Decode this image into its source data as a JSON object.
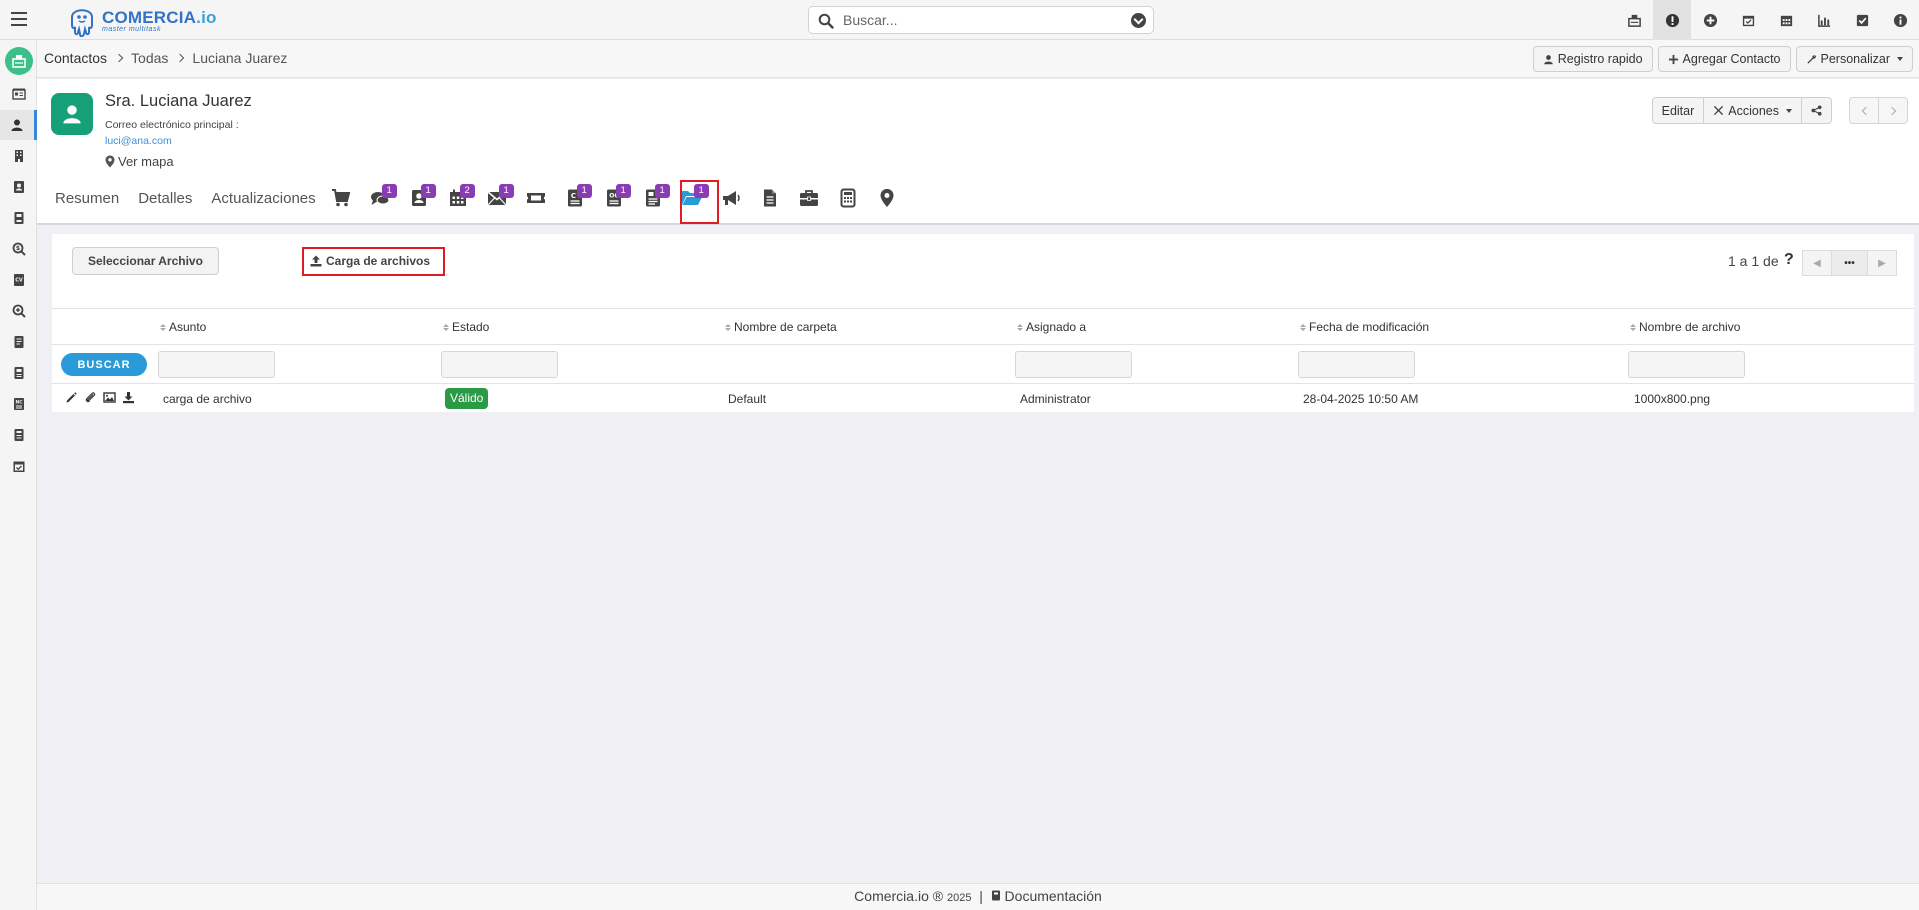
{
  "app": {
    "logo_name": "COMERCIA",
    "logo_tld": ".io",
    "logo_tagline": "master multitask"
  },
  "search": {
    "placeholder": "Buscar..."
  },
  "top_icons": [
    "desk-icon",
    "alert-icon",
    "plus-circle-icon",
    "calendar-check-icon",
    "calendar-icon",
    "chart-icon",
    "checkbox-icon",
    "info-icon"
  ],
  "sidebar": {
    "items": [
      "id-card-icon",
      "user-icon",
      "building-icon",
      "contact-book-icon",
      "book-icon",
      "search-dollar-icon",
      "cv-icon",
      "search-icon",
      "ledger-icon",
      "ledger2-icon",
      "nc-icon",
      "ledger3-icon",
      "calendar-check-icon"
    ]
  },
  "breadcrumb": {
    "root": "Contactos",
    "list": "Todas",
    "current": "Luciana Juarez"
  },
  "crumb_actions": {
    "quick": "Registro rapido",
    "add": "Agregar Contacto",
    "customize": "Personalizar"
  },
  "contact": {
    "name": "Sra. Luciana Juarez",
    "email_label": "Correo electrónico principal :",
    "email": "luci@ana.com",
    "map": "Ver mapa"
  },
  "header_actions": {
    "edit": "Editar",
    "actions": "Acciones"
  },
  "tabs": {
    "summary": "Resumen",
    "details": "Detalles",
    "updates": "Actualizaciones",
    "icons": [
      {
        "name": "cart-icon",
        "badge": ""
      },
      {
        "name": "comments-icon",
        "badge": "1"
      },
      {
        "name": "contact-card-icon",
        "badge": "1"
      },
      {
        "name": "calendar-icon",
        "badge": "2"
      },
      {
        "name": "envelope-icon",
        "badge": "1"
      },
      {
        "name": "ticket-icon",
        "badge": ""
      },
      {
        "name": "quote-icon",
        "badge": "1"
      },
      {
        "name": "order-icon",
        "badge": "1"
      },
      {
        "name": "invoice-icon",
        "badge": "1"
      },
      {
        "name": "folder-open-icon",
        "badge": "1"
      },
      {
        "name": "megaphone-icon",
        "badge": ""
      },
      {
        "name": "document-icon",
        "badge": ""
      },
      {
        "name": "briefcase-icon",
        "badge": ""
      },
      {
        "name": "calculator-icon",
        "badge": ""
      },
      {
        "name": "map-marker-icon",
        "badge": ""
      }
    ]
  },
  "files": {
    "select_button": "Seleccionar Archivo",
    "upload_button": "Carga de archivos",
    "pager_text": "1 a 1  de",
    "search_button": "BUSCAR",
    "columns": [
      "Asunto",
      "Estado",
      "Nombre de carpeta",
      "Asignado a",
      "Fecha de modificación",
      "Nombre de archivo"
    ],
    "rows": [
      {
        "subject": "carga de archivo",
        "status": "Válido",
        "folder": "Default",
        "assigned": "Administrator",
        "modified": "28-04-2025 10:50 AM",
        "filename": "1000x800.png"
      }
    ]
  },
  "footer": {
    "brand": "Comercia.io ®",
    "year": "2025",
    "sep": "|",
    "docs": "Documentación"
  },
  "colors": {
    "brand": "#3273c8",
    "accent": "#2a9ad8",
    "badge": "#8a3cb4",
    "valid": "#2b9a45",
    "avatar": "#16a07a",
    "highlight": "#e01b24"
  }
}
